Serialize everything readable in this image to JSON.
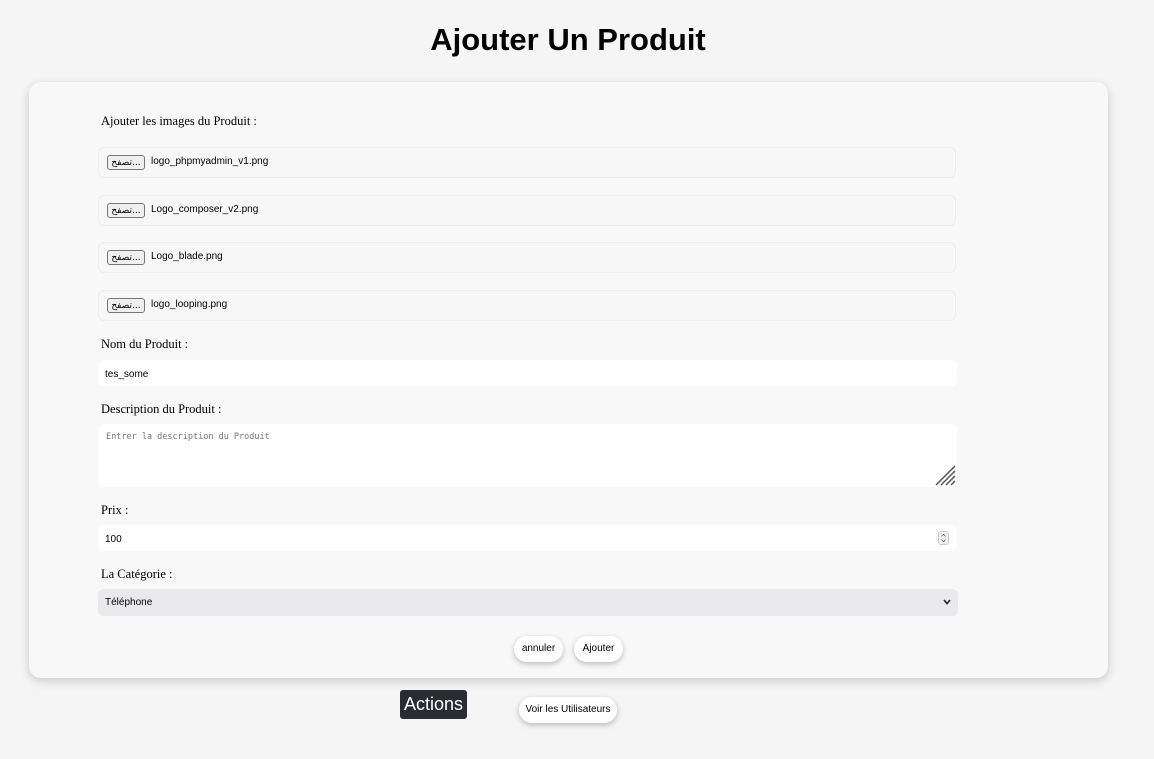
{
  "page": {
    "title": "Ajouter Un Produit"
  },
  "form": {
    "images_label": "Ajouter les images du Produit :",
    "file_inputs": [
      {
        "button": "تصفح...",
        "filename": "logo_phpmyadmin_v1.png"
      },
      {
        "button": "تصفح...",
        "filename": "Logo_composer_v2.png"
      },
      {
        "button": "تصفح...",
        "filename": "Logo_blade.png"
      },
      {
        "button": "تصفح...",
        "filename": "logo_looping.png"
      }
    ],
    "name_label": "Nom du Produit :",
    "name_value": "tes_some",
    "description_label": "Description du Produit :",
    "description_placeholder": "Entrer la description du Produit",
    "price_label": "Prix :",
    "price_value": "100",
    "category_label": "La Catégorie :",
    "category_value": "Téléphone",
    "cancel_label": "annuler",
    "submit_label": "Ajouter"
  },
  "footer": {
    "actions_label": "Actions",
    "users_button": "Voir les Utilisateurs"
  },
  "icons": {
    "resize": "resize-handle-icon",
    "spinner": "number-spinner-icon",
    "chevron": "chevron-down-icon"
  }
}
